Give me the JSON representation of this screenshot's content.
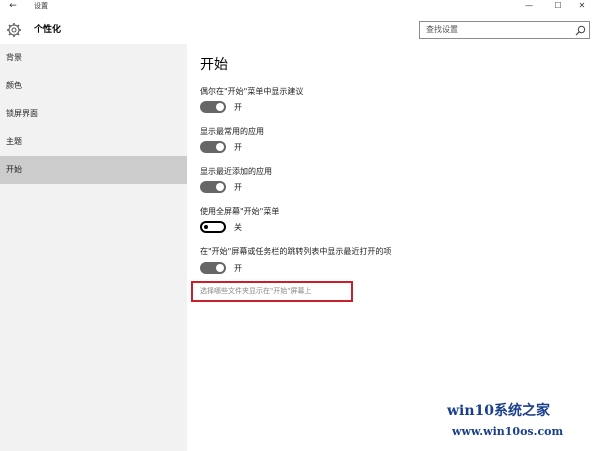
{
  "titlebar": {
    "back_glyph": "←",
    "app_title": "设置",
    "minimize_glyph": "—",
    "maximize_glyph": "☐",
    "close_glyph": "✕"
  },
  "header": {
    "icon": "gear-icon",
    "title": "个性化",
    "search_placeholder": "查找设置",
    "search_icon": "search-icon"
  },
  "sidebar": {
    "items": [
      {
        "label": "背景",
        "selected": false
      },
      {
        "label": "颜色",
        "selected": false
      },
      {
        "label": "锁屏界面",
        "selected": false
      },
      {
        "label": "主题",
        "selected": false
      },
      {
        "label": "开始",
        "selected": true
      }
    ]
  },
  "content": {
    "title": "开始",
    "settings": [
      {
        "label": "偶尔在\"开始\"菜单中显示建议",
        "state": "开",
        "on": true
      },
      {
        "label": "显示最常用的应用",
        "state": "开",
        "on": true
      },
      {
        "label": "显示最近添加的应用",
        "state": "开",
        "on": true
      },
      {
        "label": "使用全屏幕\"开始\"菜单",
        "state": "关",
        "on": false
      },
      {
        "label": "在\"开始\"屏幕或任务栏的跳转列表中显示最近打开的项",
        "state": "开",
        "on": true
      }
    ],
    "link": "选择哪些文件夹显示在\"开始\"屏幕上",
    "highlight_color": "#c8202a"
  },
  "watermark": {
    "name": "win10系统之家",
    "url": "www.win10os.com"
  }
}
